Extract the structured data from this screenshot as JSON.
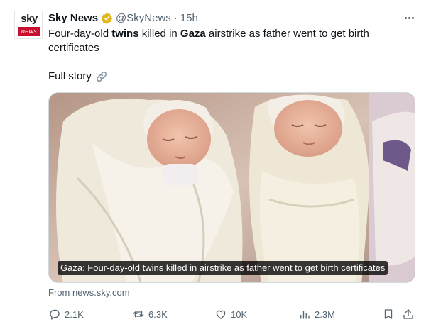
{
  "account": {
    "avatar_top": "sky",
    "avatar_bar": "news",
    "name": "Sky News",
    "handle": "@SkyNews",
    "separator": "·",
    "time": "15h"
  },
  "tweet": {
    "text_parts": [
      "Four-day-old ",
      "twins",
      " killed in ",
      "Gaza",
      " airstrike as father went to get birth certificates"
    ],
    "full_story": "Full story"
  },
  "media": {
    "caption": "Gaza: Four-day-old twins killed in airstrike as father went to get birth certificates",
    "source": "From news.sky.com"
  },
  "actions": {
    "replies": "2.1K",
    "retweets": "6.3K",
    "likes": "10K",
    "views": "2.3M"
  },
  "icons": {
    "verified": "verified-badge-icon",
    "more": "more-icon",
    "link": "link-icon",
    "reply": "reply-icon",
    "retweet": "retweet-icon",
    "like": "heart-icon",
    "views": "views-icon",
    "bookmark": "bookmark-icon",
    "share": "share-icon"
  },
  "colors": {
    "text": "#0f1419",
    "secondary": "#536471",
    "brand_red": "#c8102e",
    "verified_gold": "#e2b719"
  }
}
